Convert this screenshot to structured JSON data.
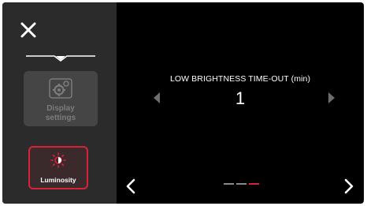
{
  "sidebar": {
    "close_icon": "close-icon",
    "tiles": [
      {
        "label": "Display\nsettings",
        "icon": "gear-icon",
        "state": "disabled"
      },
      {
        "label": "Luminosity",
        "icon": "brightness-icon",
        "state": "selected"
      }
    ]
  },
  "setting": {
    "title": "LOW BRIGHTNESS TIME-OUT (min)",
    "value": "1"
  },
  "pagination": {
    "pages": 3,
    "current": 3
  },
  "colors": {
    "accent": "#d6223a",
    "sidebar_bg": "#2b2b2b",
    "screen_bg": "#000000"
  }
}
